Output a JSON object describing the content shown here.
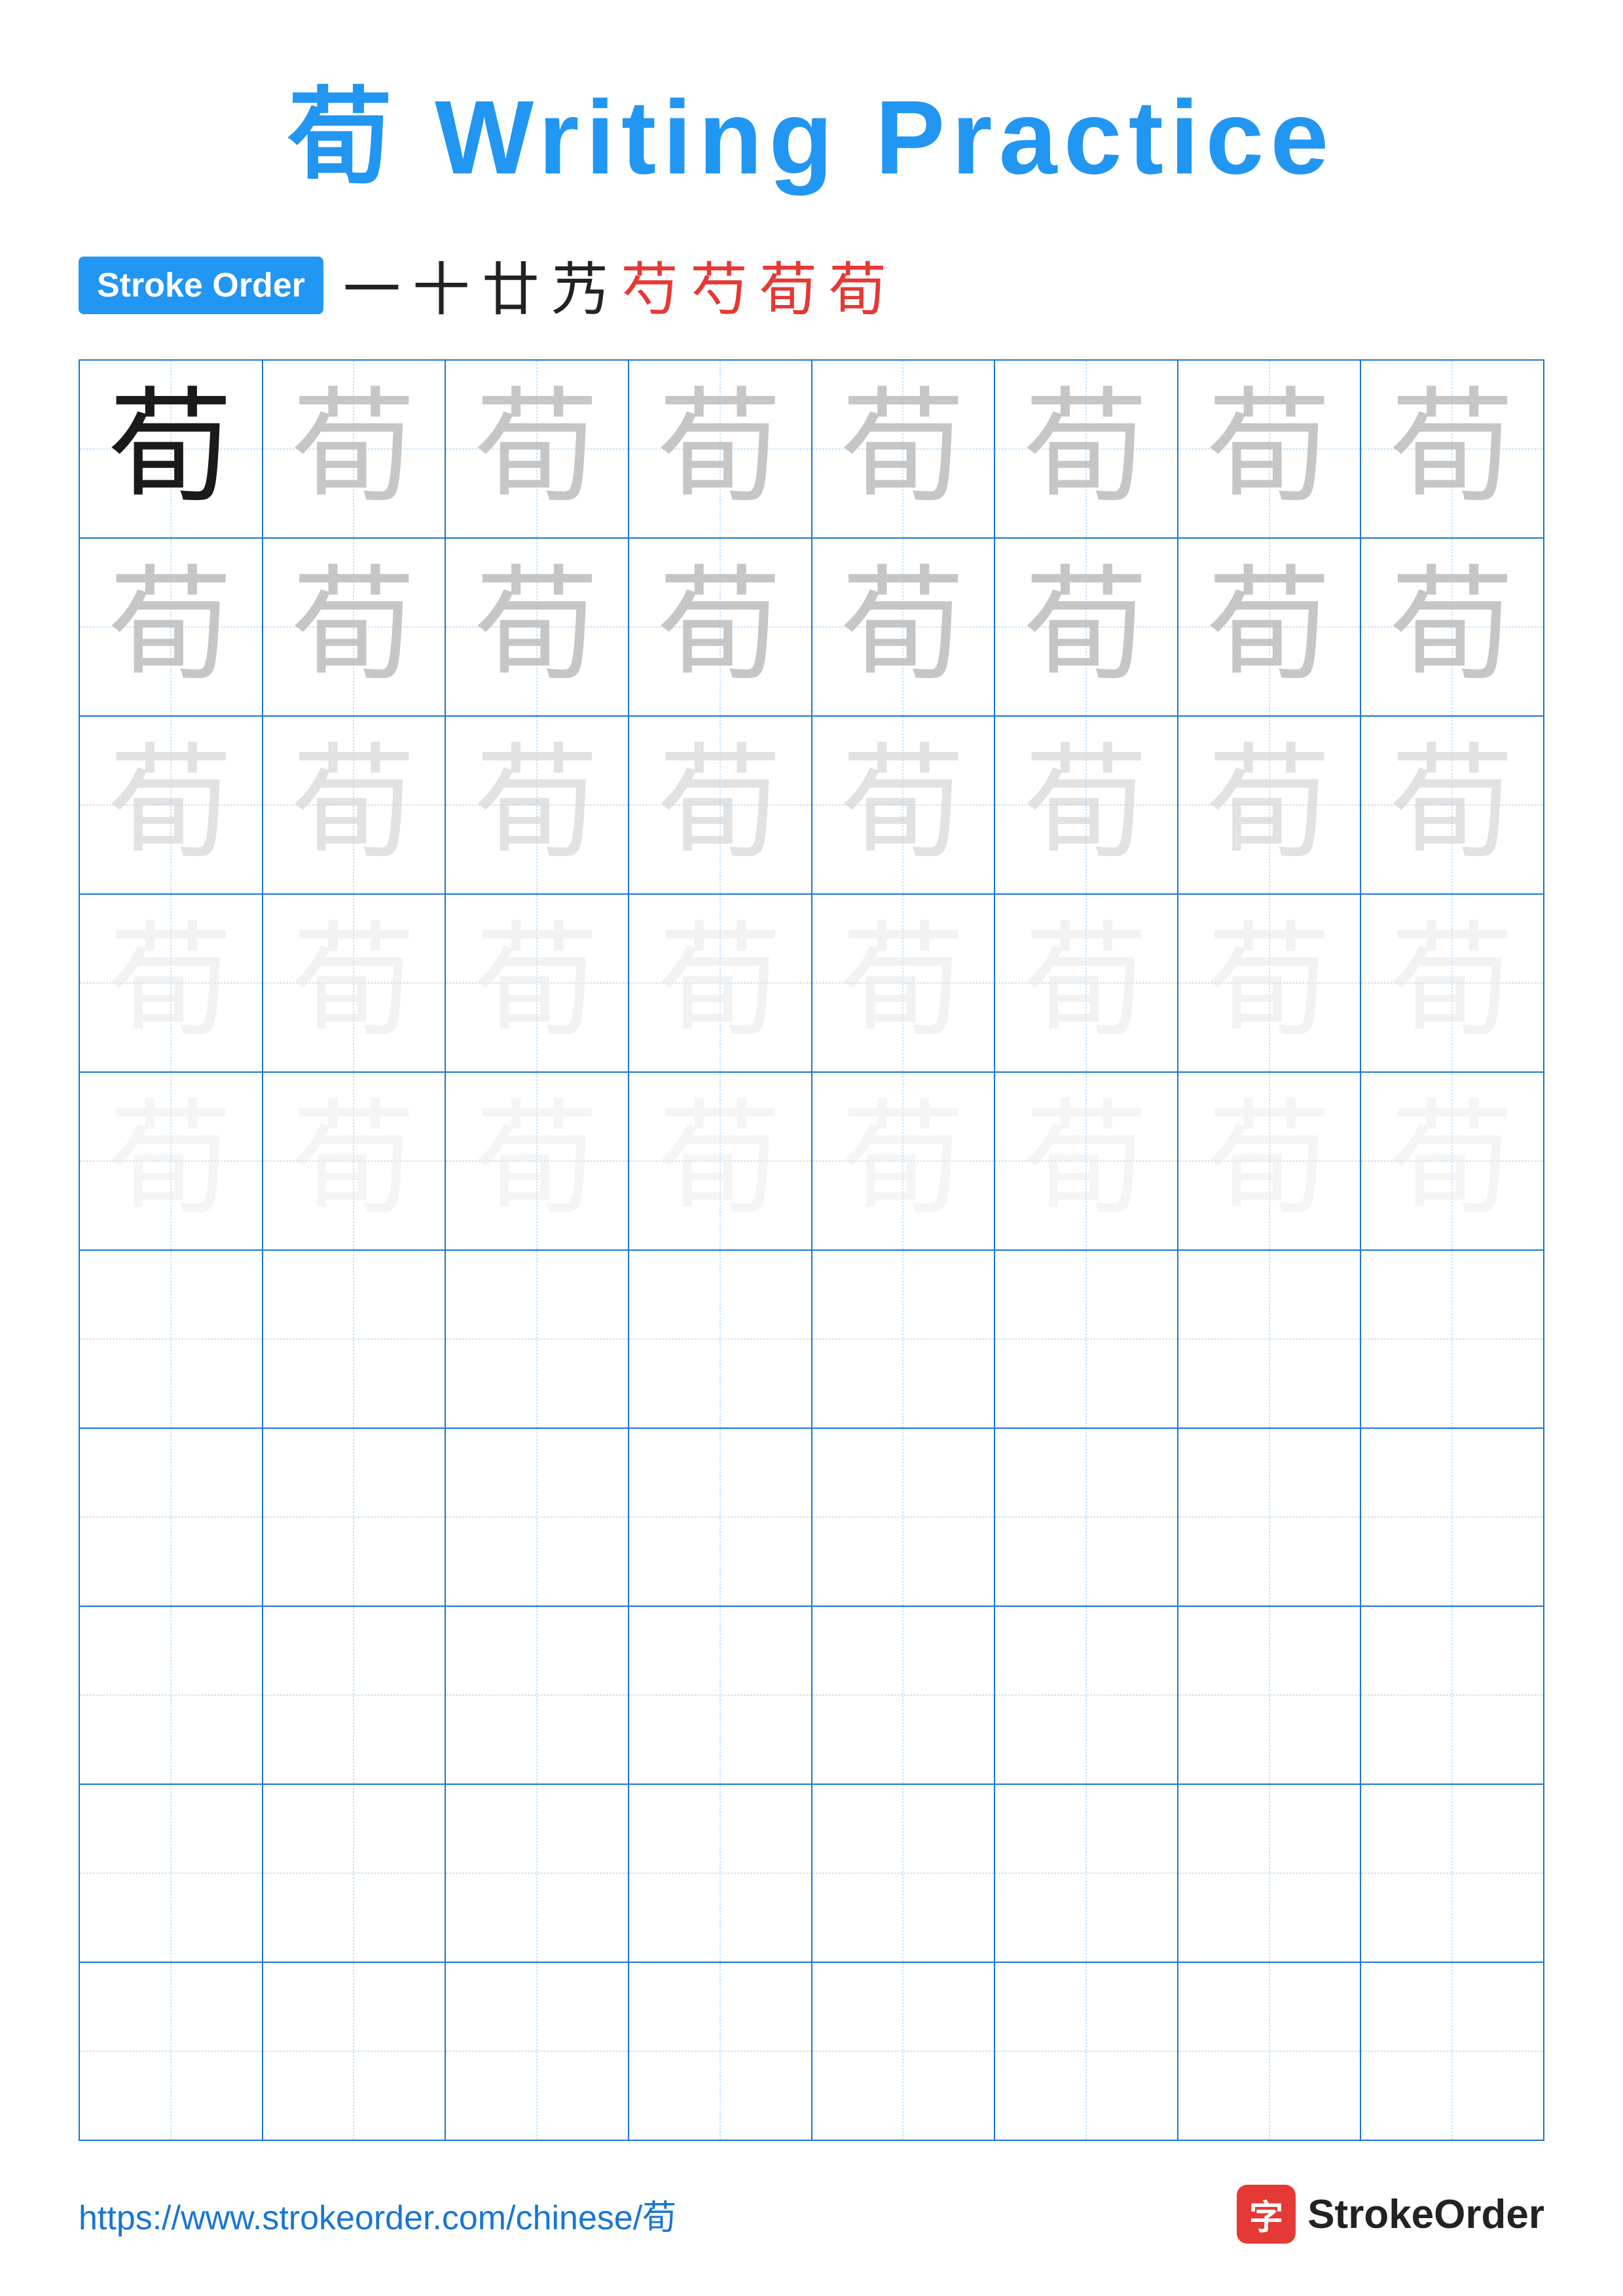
{
  "title": {
    "text": "荀 Writing Practice",
    "color": "#2196F3"
  },
  "stroke_order": {
    "badge_label": "Stroke Order",
    "sequence": [
      {
        "char": "一",
        "style": "black"
      },
      {
        "char": "十",
        "style": "black"
      },
      {
        "char": "廿",
        "style": "black"
      },
      {
        "char": "艿",
        "style": "black"
      },
      {
        "char": "芍",
        "style": "red"
      },
      {
        "char": "芍",
        "style": "red"
      },
      {
        "char": "荀",
        "style": "red"
      },
      {
        "char": "荀",
        "style": "red"
      }
    ]
  },
  "grid": {
    "rows": 10,
    "cols": 8,
    "character": "荀",
    "row_styles": [
      "solid",
      "medium-gray",
      "light-gray",
      "very-light",
      "faintest",
      "empty",
      "empty",
      "empty",
      "empty",
      "empty"
    ]
  },
  "footer": {
    "url": "https://www.strokeorder.com/chinese/荀",
    "brand": "StrokeOrder",
    "icon_char": "字"
  }
}
